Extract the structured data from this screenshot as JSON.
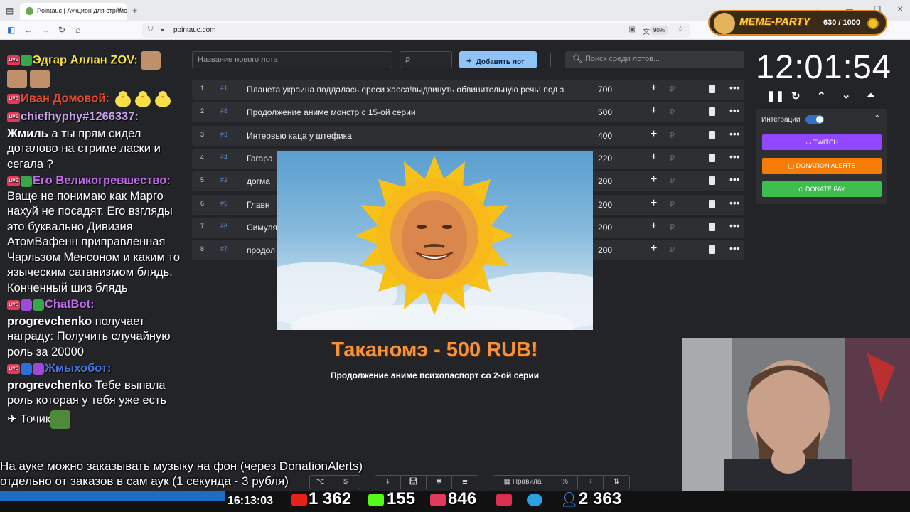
{
  "browser": {
    "tab_title": "Pointauc | Аукцион для стримє",
    "tab_close": "✕",
    "new_tab": "+",
    "url": "pointauc.com",
    "zoom": "90%"
  },
  "meme_party": {
    "logo": "MEME-PARTY",
    "progress_text": "630 / 1000",
    "progress_fraction": 0.63
  },
  "chat": [
    {
      "nick": "Эдгар Аллан ZOV:",
      "text": "",
      "nick_color": "#f7e24b"
    },
    {
      "nick": "Иван Домовой:",
      "text": "",
      "nick_color": "#e64a2e"
    },
    {
      "nick": "chiefhyphy#1266337:",
      "text": "",
      "nick_color": "#c8a2e8"
    },
    {
      "nick": "Жмиль",
      "text": "а ты прям сидел доталово на стриме ласки и сегала ?",
      "nick_color": "#ffffff"
    },
    {
      "nick": "Его Великогревшество:",
      "text": "Ваще не понимаю как Марго нахуй не посадят. Его взгляды это буквально Дивизия АтомВафенн приправленная Чарльзом Менсоном и каким то языческим сатанизмом блядь. Конченный шиз блядь",
      "nick_color": "#c46cf0"
    },
    {
      "nick": "ChatBot:",
      "text": "",
      "nick_color": "#c46cf0"
    },
    {
      "nick": "progrevchenko",
      "text": "получает награду: Получить случайную роль за 20000",
      "nick_color": "#ffffff"
    },
    {
      "nick": "Жмыхобот:",
      "text": "",
      "nick_color": "#4a74d8"
    },
    {
      "nick": "progrevchenko",
      "text": "Тебе выпала роль которая у тебя уже есть",
      "nick_color": "#ffffff"
    },
    {
      "nick": "",
      "text": "Точик",
      "nick_color": "#ffffff"
    }
  ],
  "controls": {
    "lot_placeholder": "Название нового лота",
    "price_placeholder": "₽",
    "add_button": "Добавить лот",
    "search_placeholder": "Поиск среди лотов..."
  },
  "lots": [
    {
      "n": "1",
      "id": "#1",
      "title": "Планета украина поддалась ереси хаоса!выдвинуть обвинительную речь! под з",
      "amount": "700"
    },
    {
      "n": "2",
      "id": "#8",
      "title": "Продолжение аниме монстр с 15-ой серии",
      "amount": "500"
    },
    {
      "n": "3",
      "id": "#3",
      "title": "Интервью каца у штефика",
      "amount": "400"
    },
    {
      "n": "4",
      "id": "#4",
      "title": "Гагара",
      "amount": "220"
    },
    {
      "n": "5",
      "id": "#2",
      "title": "догма",
      "amount": "200"
    },
    {
      "n": "6",
      "id": "#5",
      "title": "Главн",
      "amount": "200"
    },
    {
      "n": "7",
      "id": "#6",
      "title": "Симуля",
      "amount": "200"
    },
    {
      "n": "8",
      "id": "#7",
      "title": "продол",
      "amount": "200"
    }
  ],
  "lot_currency": "₽",
  "winner": {
    "title": "Таканомэ - 500 RUB!",
    "subtitle": "Продолжение аниме психопаспорт со 2-ой серии"
  },
  "timer": {
    "clock": "12:01:54",
    "integrations_label": "Интеграции",
    "twitch": "TWITCH",
    "donation_alerts": "DONATION ALERTS",
    "donate_pay": "DONATE PAY"
  },
  "captions": [
    "На ауке можно заказывать музыку на фон (через DonationAlerts)",
    "отдельно от заказов в сам аук (1 секунда - 3 рубля)"
  ],
  "toolbar": {
    "rules": "Правила",
    "percent": "%"
  },
  "stream_stats": {
    "time": "16:13:03",
    "youtube_viewers": "1 362",
    "kick_viewers": "155",
    "live_viewers": "846",
    "viewers_total": "2 363"
  },
  "colors": {
    "twitch": "#9146ff",
    "donation_alerts": "#f57d07",
    "donate_pay": "#3fbd4f",
    "add_button": "#90c4f9"
  }
}
